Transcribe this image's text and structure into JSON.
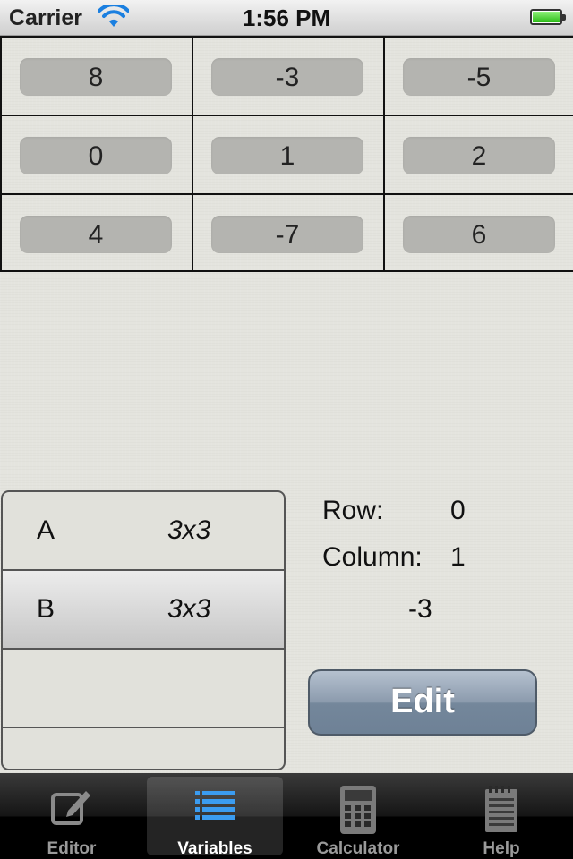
{
  "status_bar": {
    "carrier": "Carrier",
    "time": "1:56 PM"
  },
  "matrix": {
    "rows": [
      [
        "8",
        "-3",
        "-5"
      ],
      [
        "0",
        "1",
        "2"
      ],
      [
        "4",
        "-7",
        "6"
      ]
    ]
  },
  "variables": [
    {
      "name": "A",
      "dims": "3x3",
      "selected": false
    },
    {
      "name": "B",
      "dims": "3x3",
      "selected": true
    }
  ],
  "selection": {
    "row_label": "Row:",
    "row_value": "0",
    "column_label": "Column:",
    "column_value": "1",
    "cell_value": "-3"
  },
  "edit_button": "Edit",
  "tabs": [
    {
      "label": "Editor",
      "icon": "pencil-compose-icon",
      "active": false
    },
    {
      "label": "Variables",
      "icon": "list-icon",
      "active": true
    },
    {
      "label": "Calculator",
      "icon": "calculator-icon",
      "active": false
    },
    {
      "label": "Help",
      "icon": "notepad-icon",
      "active": false
    }
  ],
  "colors": {
    "tab_active_icon": "#3b9cf0",
    "edit_button": "#7f91a5"
  }
}
